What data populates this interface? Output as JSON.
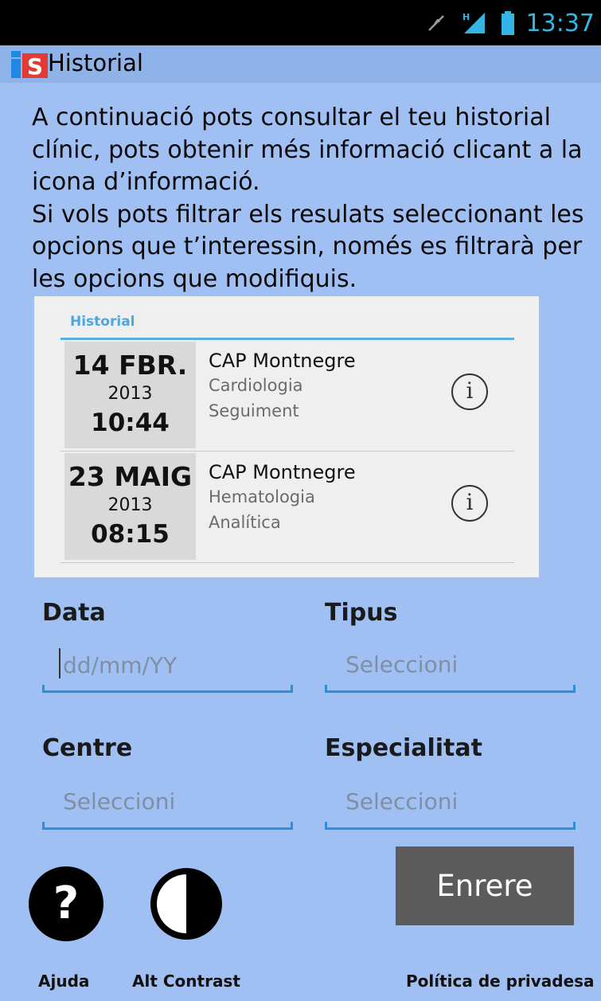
{
  "status_bar": {
    "time": "13:37"
  },
  "action_bar": {
    "title": "Historial",
    "logo_text": "iS"
  },
  "intro": {
    "paragraph1": "A continuació pots consultar el teu historial clínic, pots obtenir més informació clicant a la icona d’informació.",
    "paragraph2": "Si vols pots filtrar els resulats seleccionant les opcions que t’interessin, només es filtrarà per les opcions que modifiquis."
  },
  "history_card": {
    "title": "Historial",
    "entries": [
      {
        "day": "14 FBR.",
        "year": "2013",
        "time": "10:44",
        "center": "CAP Montnegre",
        "specialty": "Cardiologia",
        "type": "Seguiment"
      },
      {
        "day": "23 MAIG",
        "year": "2013",
        "time": "08:15",
        "center": "CAP Montnegre",
        "specialty": "Hematologia",
        "type": "Analítica"
      }
    ]
  },
  "filters": {
    "date": {
      "label": "Data",
      "placeholder": "dd/mm/YY"
    },
    "type": {
      "label": "Tipus",
      "value": "Seleccioni"
    },
    "center": {
      "label": "Centre",
      "value": "Seleccioni"
    },
    "specialty": {
      "label": "Especialitat",
      "value": "Seleccioni"
    }
  },
  "buttons": {
    "back": "Enrere"
  },
  "footer": {
    "help": "Ajuda",
    "contrast": "Alt Contrast",
    "privacy": "Política de privadesa"
  },
  "colors": {
    "background": "#a0c0f4",
    "accent": "#2f8fd4",
    "button": "#5c5c5c"
  }
}
